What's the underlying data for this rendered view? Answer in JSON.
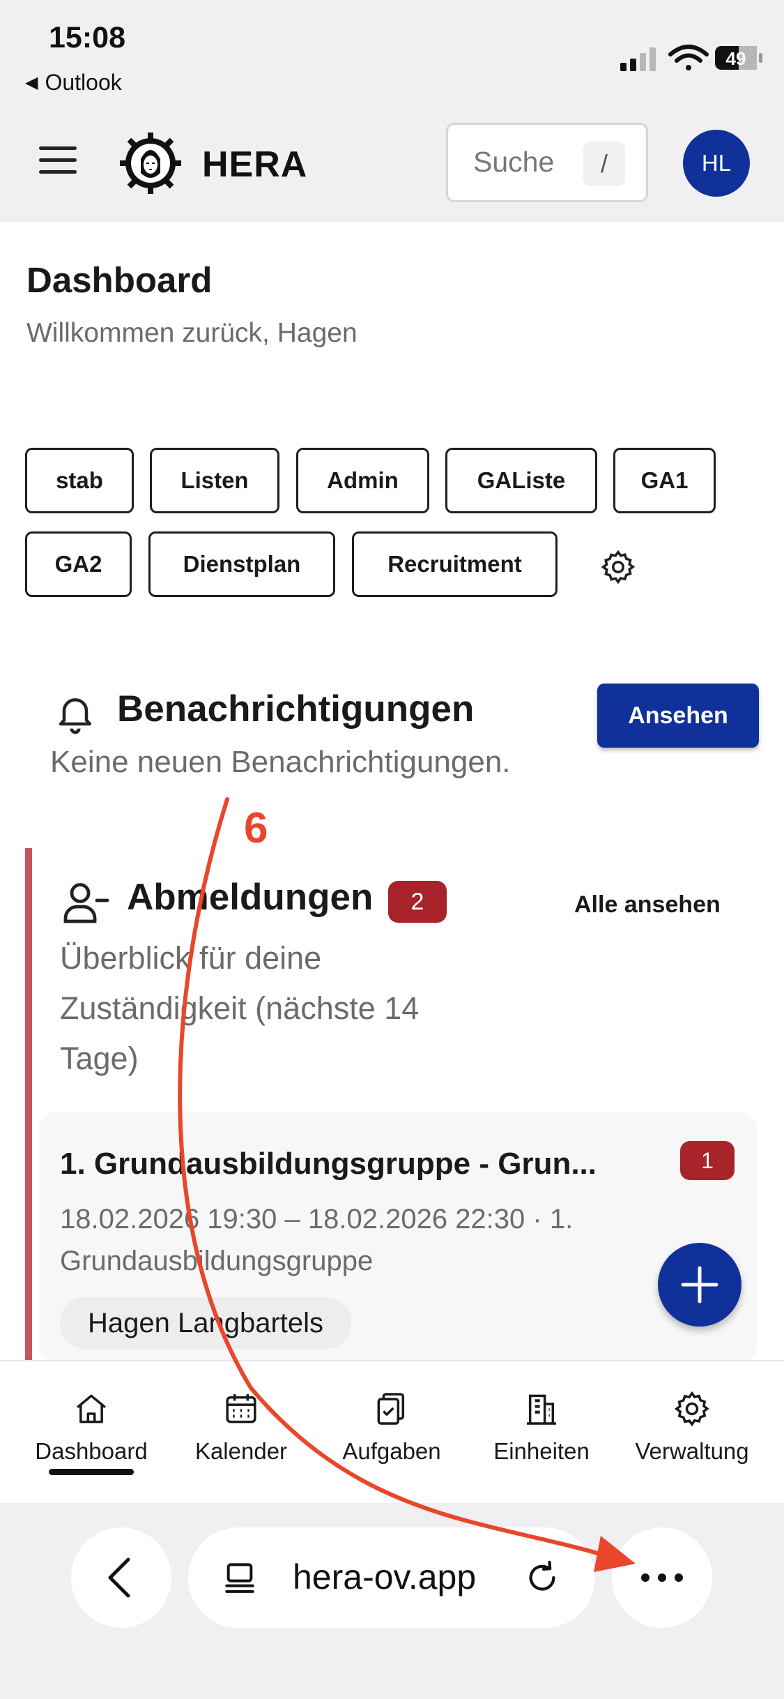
{
  "status_bar": {
    "time": "15:08",
    "back_app": "Outlook",
    "battery": "49"
  },
  "header": {
    "app_title": "HERA",
    "search_placeholder": "Suche",
    "search_shortcut": "/",
    "avatar_initials": "HL"
  },
  "dashboard": {
    "title": "Dashboard",
    "subtitle": "Willkommen zurück, Hagen",
    "chips": [
      "stab",
      "Listen",
      "Admin",
      "GAListe",
      "GA1",
      "GA2",
      "Dienstplan",
      "Recruitment"
    ]
  },
  "notifications": {
    "title": "Benachrichtigungen",
    "text": "Keine neuen Benachrichtigungen.",
    "button": "Ansehen"
  },
  "absences": {
    "title": "Abmeldungen",
    "count": "2",
    "view_all": "Alle ansehen",
    "description": "Überblick für deine Zuständigkeit (nächste 14 Tage)",
    "card": {
      "title": "1. Grundausbildungsgruppe - Grun...",
      "badge": "1",
      "meta": "18.02.2026 19:30 – 18.02.2026 22:30 · 1. Grundausbildungsgruppe",
      "person": "Hagen Langbartels"
    }
  },
  "bottom_nav": {
    "items": [
      {
        "label": "Dashboard",
        "icon": "home-icon",
        "active": true
      },
      {
        "label": "Kalender",
        "icon": "calendar-icon",
        "active": false
      },
      {
        "label": "Aufgaben",
        "icon": "tasks-icon",
        "active": false
      },
      {
        "label": "Einheiten",
        "icon": "building-icon",
        "active": false
      },
      {
        "label": "Verwaltung",
        "icon": "gear-icon",
        "active": false
      }
    ]
  },
  "browser": {
    "url": "hera-ov.app"
  },
  "annotation": {
    "number": "6",
    "color": "#e8472b"
  },
  "colors": {
    "primary": "#10319a",
    "badge": "#a8232a",
    "accent_bar": "#c4575c"
  }
}
